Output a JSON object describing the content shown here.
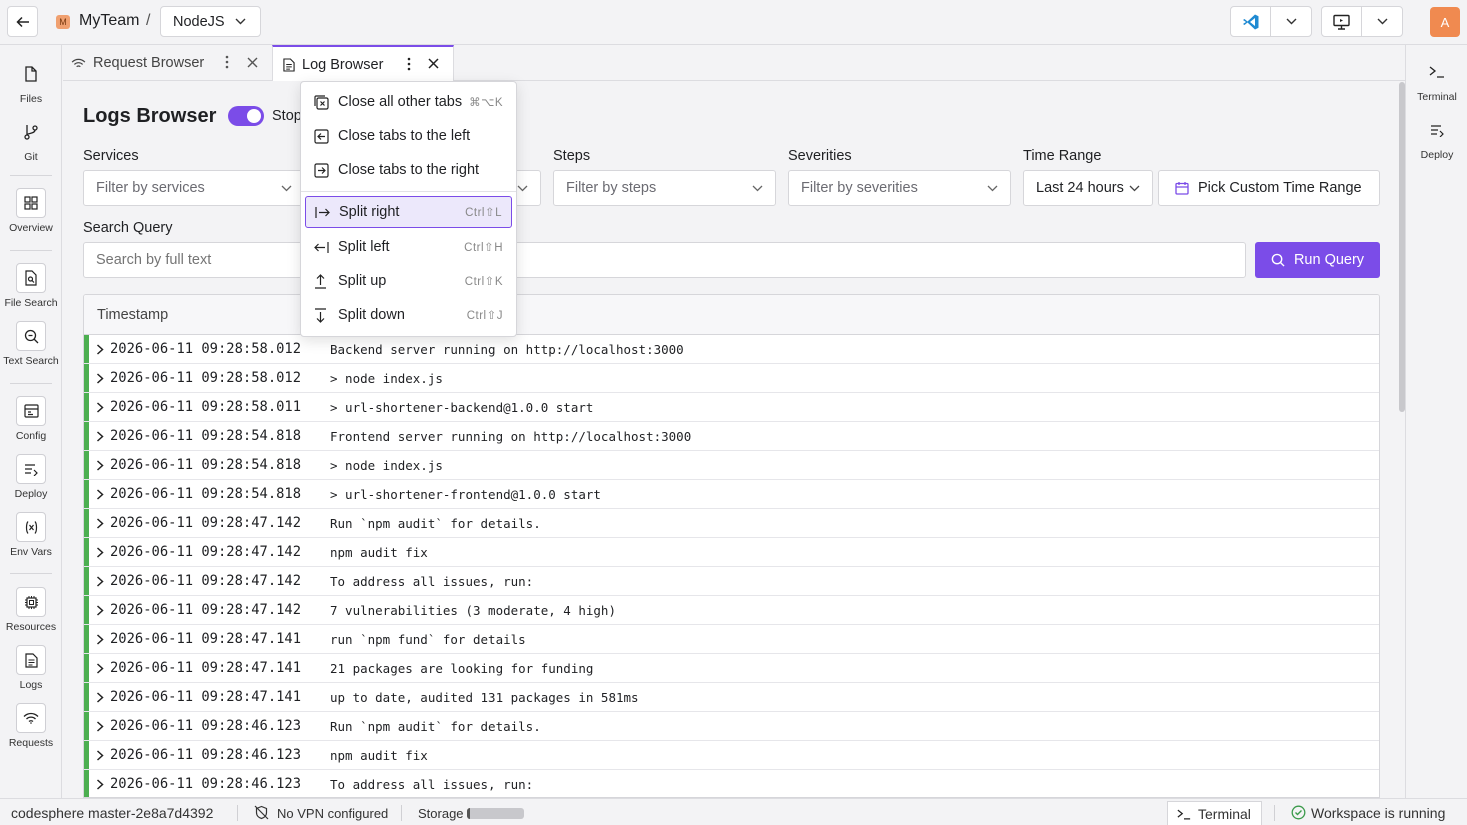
{
  "header": {
    "team_initial": "M",
    "team_name": "MyTeam",
    "separator": "/",
    "workspace": "NodeJS",
    "avatar_initial": "A"
  },
  "left_sidebar": {
    "items": [
      {
        "label": "Files",
        "icon": "file-icon"
      },
      {
        "label": "Git",
        "icon": "git-branch-icon"
      },
      {
        "label": "Overview",
        "icon": "grid-icon"
      },
      {
        "label": "File Search",
        "icon": "file-search-icon"
      },
      {
        "label": "Text Search",
        "icon": "text-search-icon"
      },
      {
        "label": "Config",
        "icon": "config-icon"
      },
      {
        "label": "Deploy",
        "icon": "deploy-icon"
      },
      {
        "label": "Env Vars",
        "icon": "env-vars-icon"
      },
      {
        "label": "Resources",
        "icon": "chip-icon"
      },
      {
        "label": "Logs",
        "icon": "logs-icon"
      },
      {
        "label": "Requests",
        "icon": "wifi-icon"
      }
    ]
  },
  "right_sidebar": {
    "items": [
      {
        "label": "Terminal",
        "icon": "terminal-icon"
      },
      {
        "label": "Deploy",
        "icon": "deploy-icon"
      }
    ]
  },
  "tabs": [
    {
      "label": "Request Browser",
      "active": false
    },
    {
      "label": "Log Browser",
      "active": true
    }
  ],
  "main": {
    "title": "Logs Browser",
    "toggle_label": "Stop",
    "toggle_on": true,
    "filters": {
      "services": {
        "label": "Services",
        "placeholder": "Filter by services"
      },
      "steps": {
        "label": "Steps",
        "placeholder": "Filter by steps"
      },
      "severities": {
        "label": "Severities",
        "placeholder": "Filter by severities"
      },
      "time_range": {
        "label": "Time Range",
        "value": "Last 24 hours",
        "custom_button": "Pick Custom Time Range"
      }
    },
    "search": {
      "label": "Search Query",
      "placeholder": "Search by full text",
      "run_button": "Run Query"
    }
  },
  "log_table": {
    "columns": [
      "Timestamp"
    ],
    "rows": [
      {
        "ts": "2026-06-11 09:28:58.012",
        "msg": "Backend server running on http://localhost:3000"
      },
      {
        "ts": "2026-06-11 09:28:58.012",
        "msg": "> node index.js"
      },
      {
        "ts": "2026-06-11 09:28:58.011",
        "msg": "> url-shortener-backend@1.0.0 start"
      },
      {
        "ts": "2026-06-11 09:28:54.818",
        "msg": "Frontend server running on http://localhost:3000"
      },
      {
        "ts": "2026-06-11 09:28:54.818",
        "msg": "> node index.js"
      },
      {
        "ts": "2026-06-11 09:28:54.818",
        "msg": "> url-shortener-frontend@1.0.0 start"
      },
      {
        "ts": "2026-06-11 09:28:47.142",
        "msg": "Run `npm audit` for details."
      },
      {
        "ts": "2026-06-11 09:28:47.142",
        "msg": "npm audit fix"
      },
      {
        "ts": "2026-06-11 09:28:47.142",
        "msg": "To address all issues, run:"
      },
      {
        "ts": "2026-06-11 09:28:47.142",
        "msg": "7 vulnerabilities (3 moderate, 4 high)"
      },
      {
        "ts": "2026-06-11 09:28:47.141",
        "msg": "run `npm fund` for details"
      },
      {
        "ts": "2026-06-11 09:28:47.141",
        "msg": "21 packages are looking for funding"
      },
      {
        "ts": "2026-06-11 09:28:47.141",
        "msg": "up to date, audited 131 packages in 581ms"
      },
      {
        "ts": "2026-06-11 09:28:46.123",
        "msg": "Run `npm audit` for details."
      },
      {
        "ts": "2026-06-11 09:28:46.123",
        "msg": "npm audit fix"
      },
      {
        "ts": "2026-06-11 09:28:46.123",
        "msg": "To address all issues, run:"
      }
    ]
  },
  "context_menu": {
    "items": [
      {
        "label": "Close all other tabs",
        "shortcut": "⌘⌥K",
        "icon": "close-others-icon"
      },
      {
        "label": "Close tabs to the left",
        "shortcut": "",
        "icon": "close-left-icon"
      },
      {
        "label": "Close tabs to the right",
        "shortcut": "",
        "icon": "close-right-icon"
      },
      {
        "label": "Split right",
        "shortcut": "Ctrl⇧L",
        "icon": "split-right-icon",
        "highlighted": true
      },
      {
        "label": "Split left",
        "shortcut": "Ctrl⇧H",
        "icon": "split-left-icon"
      },
      {
        "label": "Split up",
        "shortcut": "Ctrl⇧K",
        "icon": "split-up-icon"
      },
      {
        "label": "Split down",
        "shortcut": "Ctrl⇧J",
        "icon": "split-down-icon"
      }
    ]
  },
  "status_bar": {
    "workspace_id": "codesphere master-2e8a7d4392",
    "vpn": "No VPN configured",
    "storage_label": "Storage",
    "terminal": "Terminal",
    "workspace_status": "Workspace is running"
  },
  "colors": {
    "accent": "#7b4ce8",
    "success": "#4caf50",
    "avatar": "#f08a50"
  }
}
